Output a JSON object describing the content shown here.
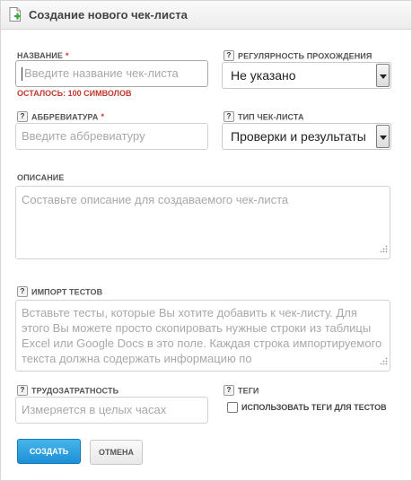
{
  "header": {
    "title": "Создание нового чек-листа",
    "icon": "document-add-icon"
  },
  "name": {
    "label": "Название",
    "required_mark": "*",
    "placeholder": "Введите название чек-листа",
    "value": "",
    "counter": "Осталось: 100 символов"
  },
  "regularity": {
    "label": "Регулярность прохождения",
    "selected": "Не указано"
  },
  "abbreviation": {
    "label": "Аббревиатура",
    "required_mark": "*",
    "placeholder": "Введите аббревиатуру",
    "value": ""
  },
  "checklist_type": {
    "label": "Тип чек-листа",
    "selected": "Проверки и результаты"
  },
  "description": {
    "label": "Описание",
    "placeholder": "Составьте описание для создаваемого чек-листа",
    "value": ""
  },
  "import_tests": {
    "label": "Импорт тестов",
    "placeholder": "Вставьте тесты, которые Вы хотите добавить к чек-листу. Для этого Вы можете просто скопировать нужные строки из таблицы Excel или Google Docs в это поле. Каждая строка импортируемого текста должна содержать информацию по",
    "value": ""
  },
  "effort": {
    "label": "Трудозатратность",
    "placeholder": "Измеряется в целых часах",
    "value": ""
  },
  "tags": {
    "label": "Теги",
    "checkbox_label": "Использовать теги для тестов",
    "checked": false
  },
  "actions": {
    "create_label": "Создать",
    "cancel_label": "Отмена"
  },
  "help_glyph": "?",
  "colors": {
    "accent": "#2a9fe0",
    "required": "#c0392b",
    "border": "#d2d2d2"
  }
}
